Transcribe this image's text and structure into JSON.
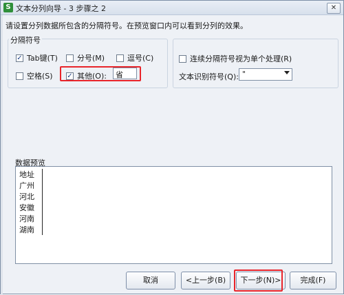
{
  "window": {
    "title": "文本分列向导 - 3 步骤之 2",
    "app_icon": "S",
    "close_label": "✕"
  },
  "instruction": "请设置分列数据所包含的分隔符号。在预览窗口内可以看到分列的效果。",
  "delimiters": {
    "group_label": "分隔符号",
    "tab": {
      "label": "Tab键(T)",
      "checked": true
    },
    "semicolon": {
      "label": "分号(M)",
      "checked": false
    },
    "comma": {
      "label": "逗号(C)",
      "checked": false
    },
    "space": {
      "label": "空格(S)",
      "checked": false
    },
    "other": {
      "label": "其他(O):",
      "checked": true,
      "value": "省"
    }
  },
  "options": {
    "consecutive": {
      "label": "连续分隔符号视为单个处理(R)",
      "checked": false
    },
    "qualifier_label": "文本识别符号(Q):",
    "qualifier_value": "\""
  },
  "preview": {
    "label": "数据预览",
    "rows": [
      "地址",
      "广州",
      "河北",
      "安徽",
      "河南",
      "湖南"
    ]
  },
  "buttons": {
    "cancel": "取消",
    "back": "<上一步(B)",
    "next": "下一步(N)>",
    "finish": "完成(F)"
  },
  "colors": {
    "highlight": "#e8242a",
    "window_bg": "#eef1f6"
  }
}
